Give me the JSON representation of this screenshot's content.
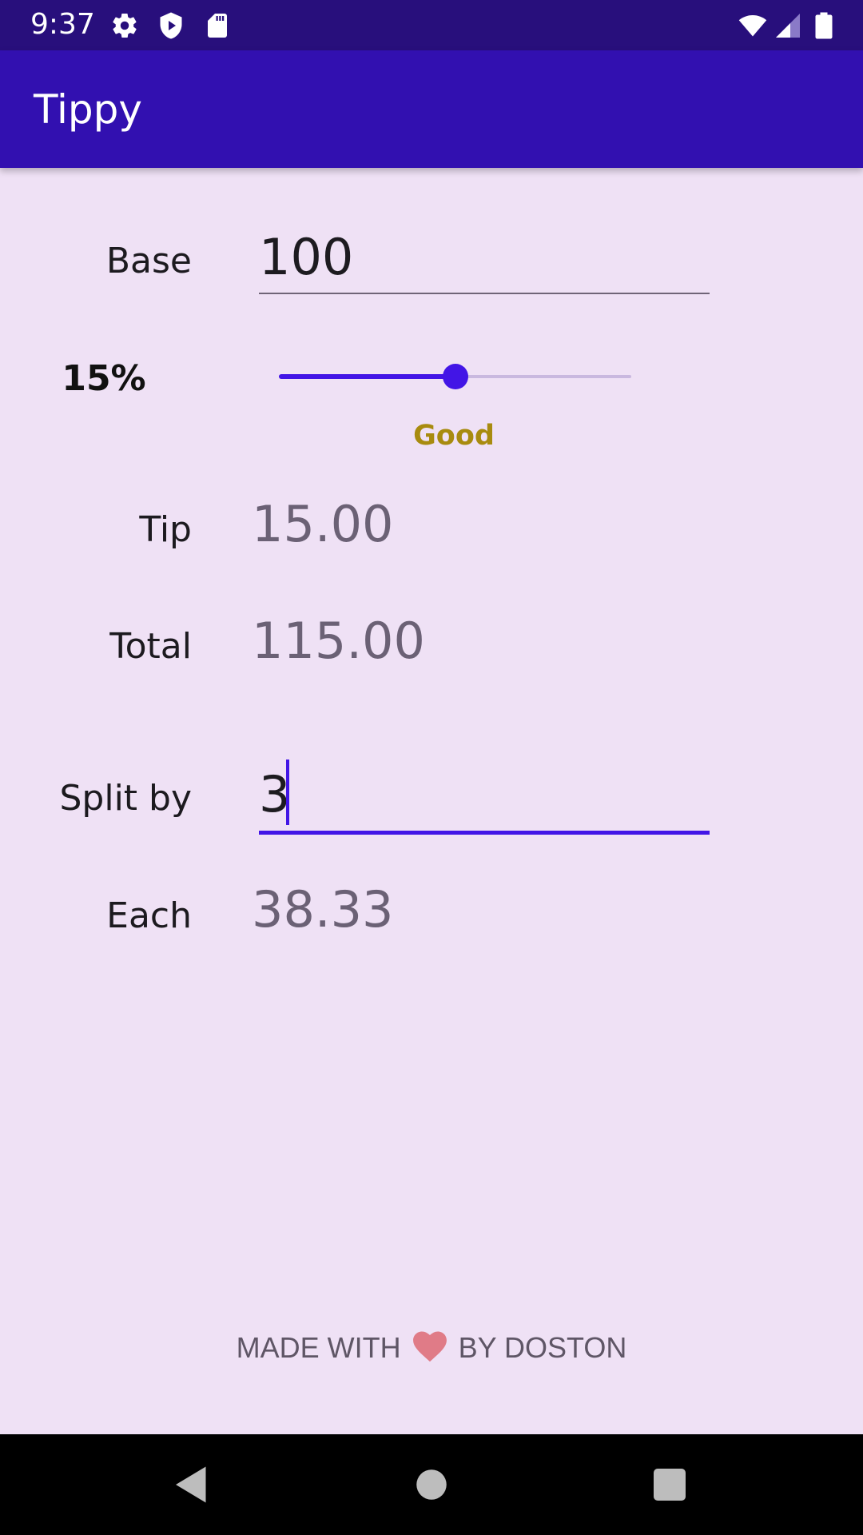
{
  "status_bar": {
    "time": "9:37",
    "left_icons": [
      "gear-icon",
      "shield-icon",
      "sd-card-icon"
    ],
    "right_icons": [
      "wifi-icon",
      "signal-icon",
      "battery-icon"
    ]
  },
  "app_bar": {
    "title": "Tippy"
  },
  "base": {
    "label": "Base",
    "value": "100"
  },
  "tip_percent": {
    "label": "15%",
    "value": 15,
    "max": 30,
    "description": "Good",
    "description_color": "#a88b0f"
  },
  "tip": {
    "label": "Tip",
    "value": "15.00"
  },
  "total": {
    "label": "Total",
    "value": "115.00"
  },
  "split": {
    "label": "Split by",
    "value": "3"
  },
  "each": {
    "label": "Each",
    "value": "38.33"
  },
  "footer": {
    "before": "MADE WITH",
    "after": "BY DOSTON",
    "icon": "heart-icon"
  },
  "nav_bar": {
    "icons": [
      "back-icon",
      "home-icon",
      "recents-icon"
    ]
  },
  "colors": {
    "accent": "#4215e6",
    "app_bar": "#3210b0",
    "status_bar": "#280f7c",
    "background": "#efe1f5"
  }
}
